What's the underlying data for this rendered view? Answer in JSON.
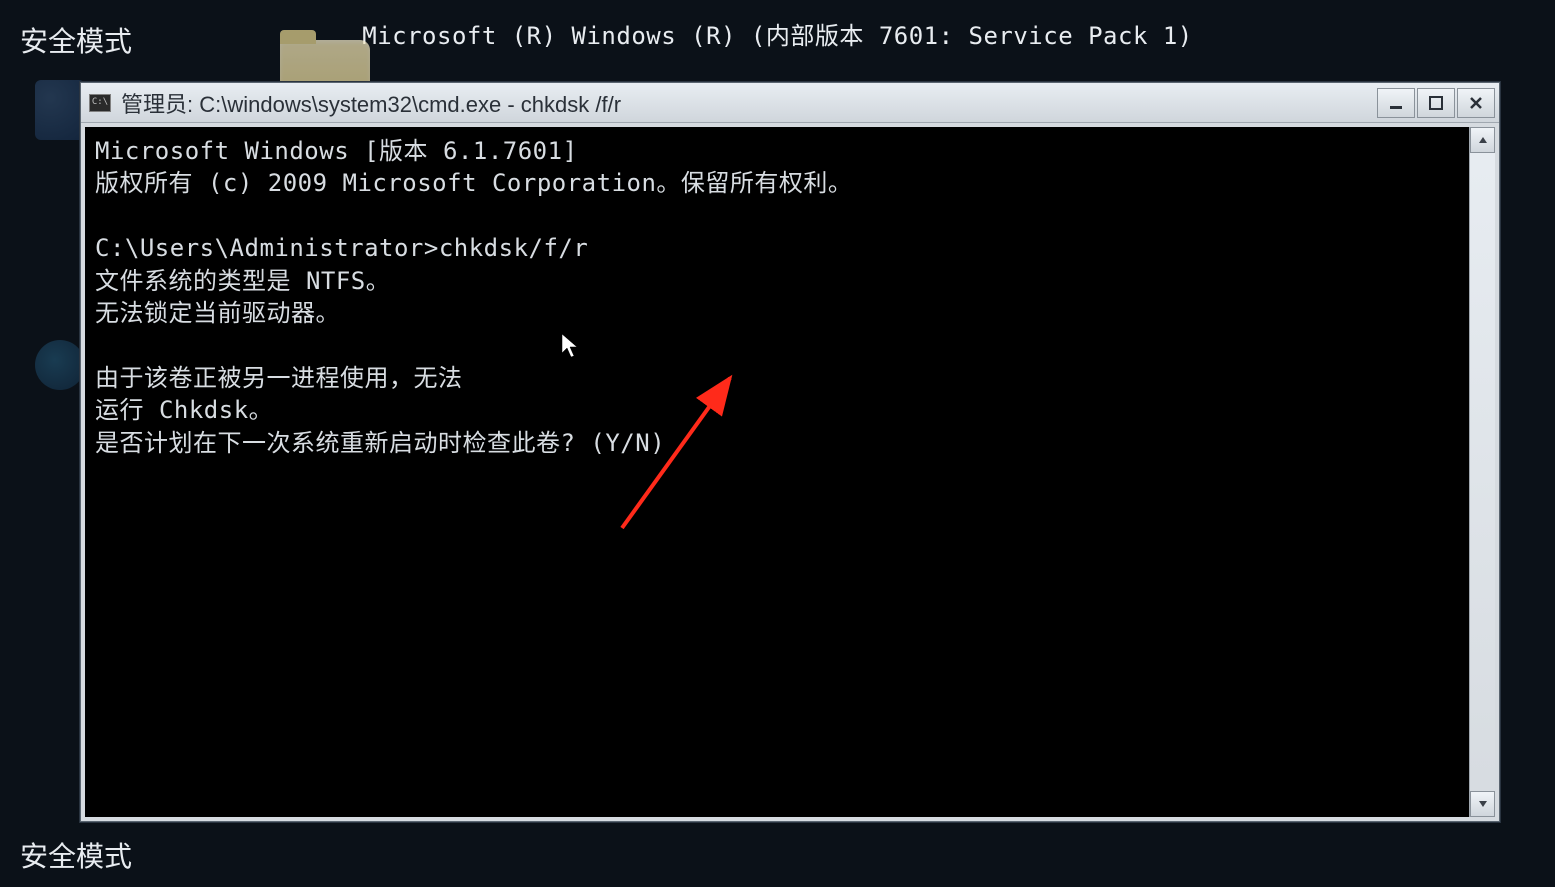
{
  "desktop": {
    "safe_mode_top": "安全模式",
    "safe_mode_bottom": "安全模式",
    "build_info": "Microsoft (R) Windows (R) (内部版本 7601: Service Pack 1)"
  },
  "window": {
    "title_icon_label": "C:\\",
    "title": "管理员: C:\\windows\\system32\\cmd.exe - chkdsk /f/r"
  },
  "console": {
    "lines": [
      "Microsoft Windows [版本 6.1.7601]",
      "版权所有 (c) 2009 Microsoft Corporation。保留所有权利。",
      "",
      "C:\\Users\\Administrator>chkdsk/f/r",
      "文件系统的类型是 NTFS。",
      "无法锁定当前驱动器。",
      "",
      "由于该卷正被另一进程使用，无法",
      "运行 Chkdsk。",
      "是否计划在下一次系统重新启动时检查此卷? (Y/N) "
    ]
  }
}
